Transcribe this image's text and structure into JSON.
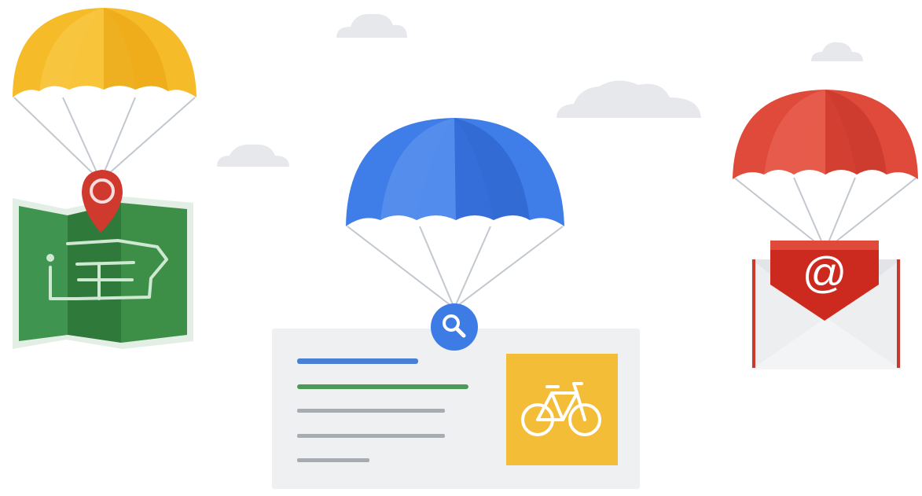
{
  "colors": {
    "background": "#ffffff",
    "cloud": "#e3e5e8",
    "yellow": "#f6bb29",
    "yellow_dark": "#e9a313",
    "blue": "#3f7ee8",
    "blue_dark": "#2f63cf",
    "red": "#e04a3b",
    "red_dark": "#c9392c",
    "map_green": "#3d8f48",
    "map_green_dark": "#2f7a3a",
    "map_border": "#e3efe4",
    "card_bg": "#eef0f2",
    "line_blue": "#4a7fd6",
    "line_green": "#4b9a58",
    "line_gray": "#a7acb2",
    "bike_tile": "#f3bd37",
    "envelope": "#eceef0",
    "string": "#bfc5cc"
  },
  "icons": {
    "map_pin": "map-pin-icon",
    "search": "search-icon",
    "bicycle": "bicycle-icon",
    "at_sign": "at-sign-icon"
  },
  "envelope_glyph": "@"
}
